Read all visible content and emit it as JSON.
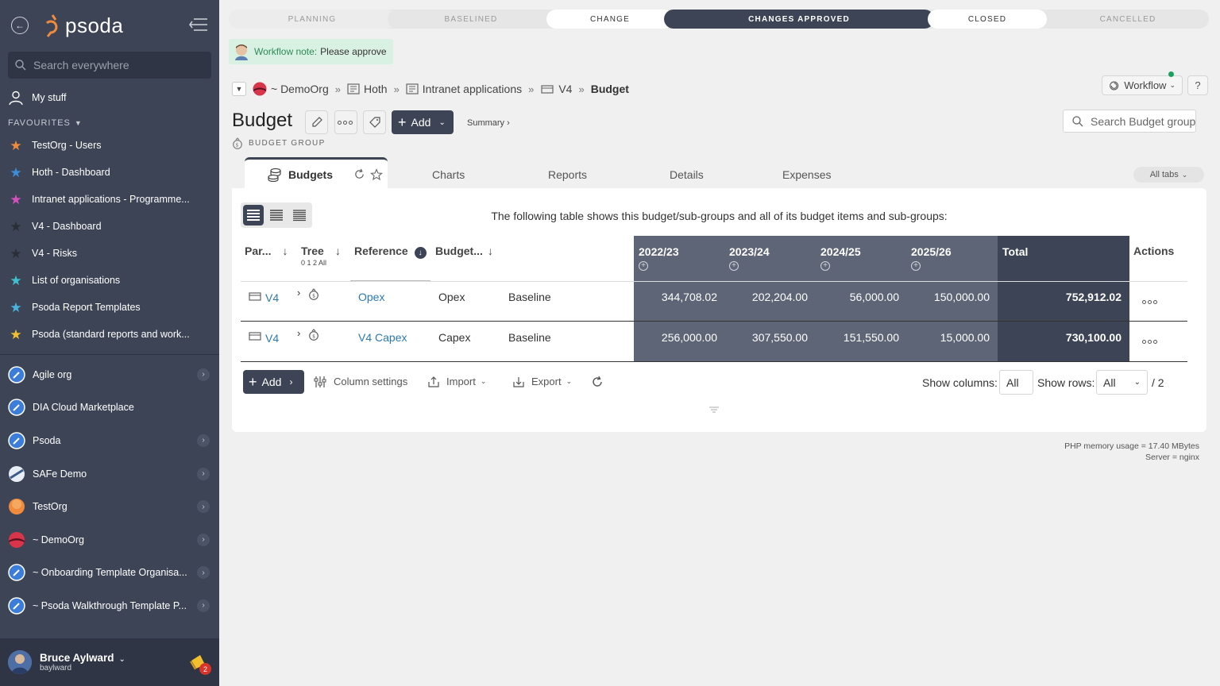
{
  "sidebar": {
    "logo": "psoda",
    "search_placeholder": "Search everywhere",
    "my_stuff": "My stuff",
    "favourites_heading": "FAVOURITES",
    "favourites": [
      {
        "label": "TestOrg - Users",
        "color": "#f08a3c"
      },
      {
        "label": "Hoth - Dashboard",
        "color": "#3b8fd9"
      },
      {
        "label": "Intranet applications - Programme...",
        "color": "#d94fbf"
      },
      {
        "label": "V4 - Dashboard",
        "color": "#3a3f4a"
      },
      {
        "label": "V4 - Risks",
        "color": "#3a3f4a"
      },
      {
        "label": "List of organisations",
        "color": "#3ec1d3"
      },
      {
        "label": "Psoda Report Templates",
        "color": "#49b4e0"
      },
      {
        "label": "Psoda (standard reports and work...",
        "color": "#f2c02f"
      }
    ],
    "orgs": [
      {
        "label": "Agile org",
        "kind": "pencil"
      },
      {
        "label": "DIA Cloud Marketplace",
        "kind": "pencil"
      },
      {
        "label": "Psoda",
        "kind": "pencil"
      },
      {
        "label": "SAFe Demo",
        "kind": "safe"
      },
      {
        "label": "TestOrg",
        "kind": "orange"
      },
      {
        "label": "~ DemoOrg",
        "kind": "red"
      },
      {
        "label": "~ Onboarding Template Organisa...",
        "kind": "pencil"
      },
      {
        "label": "~ Psoda Walkthrough Template P...",
        "kind": "pencil"
      }
    ],
    "user": {
      "name": "Bruce Aylward",
      "username": "baylward",
      "notifications": "2"
    }
  },
  "stages": [
    "PLANNING",
    "BASELINED",
    "CHANGE",
    "CHANGES APPROVED",
    "CLOSED",
    "CANCELLED"
  ],
  "workflow_note": {
    "label": "Workflow note:",
    "text": "Please approve"
  },
  "breadcrumb": [
    "~ DemoOrg",
    "Hoth",
    "Intranet applications",
    "V4",
    "Budget"
  ],
  "header": {
    "workflow": "Workflow",
    "help": "?",
    "title": "Budget",
    "add": "Add",
    "summary": "Summary ›",
    "subtype": "BUDGET GROUP",
    "search_placeholder": "Search Budget group"
  },
  "tabs": {
    "active": "Budgets",
    "others": [
      "Charts",
      "Reports",
      "Details",
      "Expenses"
    ],
    "all": "All tabs"
  },
  "table": {
    "description": "The following table shows this budget/sub-groups and all of its budget items and sub-groups:",
    "columns": {
      "parent": "Par...",
      "tree": "Tree",
      "tree_levels": "0 1 2 All",
      "reference": "Reference",
      "budget": "Budget...",
      "years": [
        "2022/23",
        "2023/24",
        "2024/25",
        "2025/26"
      ],
      "total": "Total",
      "actions": "Actions"
    },
    "rows": [
      {
        "parent": "V4",
        "reference": "Opex",
        "budget": "Opex",
        "type": "Baseline",
        "values": [
          "344,708.02",
          "202,204.00",
          "56,000.00",
          "150,000.00"
        ],
        "total": "752,912.02"
      },
      {
        "parent": "V4",
        "reference": "V4 Capex",
        "budget": "Capex",
        "type": "Baseline",
        "values": [
          "256,000.00",
          "307,550.00",
          "151,550.00",
          "15,000.00"
        ],
        "total": "730,100.00"
      }
    ]
  },
  "footer": {
    "add": "Add",
    "column_settings": "Column settings",
    "import": "Import",
    "export": "Export",
    "show_columns_label": "Show columns:",
    "show_columns_value": "All",
    "show_rows_label": "Show rows:",
    "show_rows_value": "All",
    "rows_total": "/ 2"
  },
  "server": {
    "memory": "PHP memory usage = 17.40 MBytes",
    "server": "Server = nginx"
  }
}
